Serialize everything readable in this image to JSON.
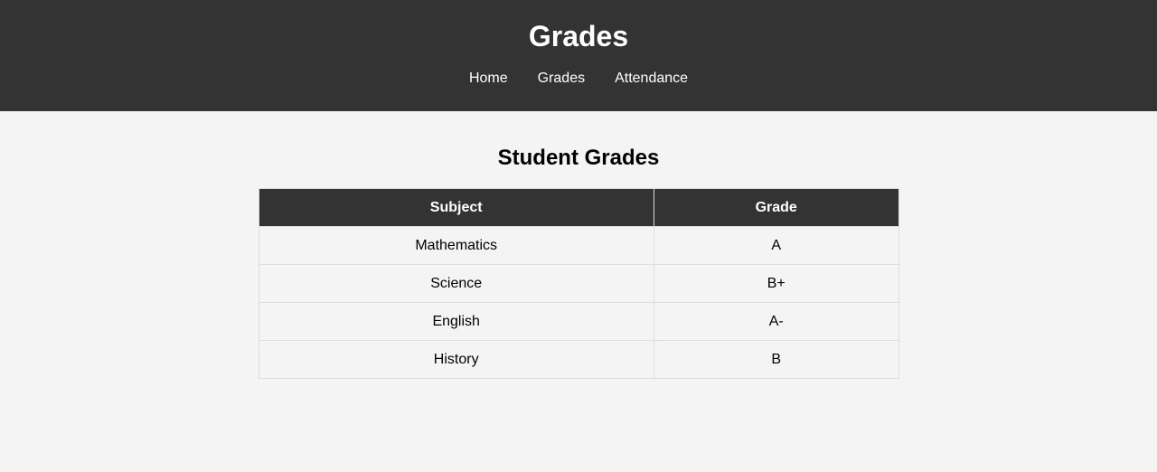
{
  "header": {
    "title": "Grades",
    "nav": [
      {
        "label": "Home"
      },
      {
        "label": "Grades"
      },
      {
        "label": "Attendance"
      }
    ]
  },
  "main": {
    "heading": "Student Grades",
    "table": {
      "columns": [
        "Subject",
        "Grade"
      ],
      "rows": [
        {
          "subject": "Mathematics",
          "grade": "A"
        },
        {
          "subject": "Science",
          "grade": "B+"
        },
        {
          "subject": "English",
          "grade": "A-"
        },
        {
          "subject": "History",
          "grade": "B"
        }
      ]
    }
  },
  "colors": {
    "header_bg": "#333333",
    "page_bg": "#f4f4f4",
    "border": "#dddddd"
  }
}
